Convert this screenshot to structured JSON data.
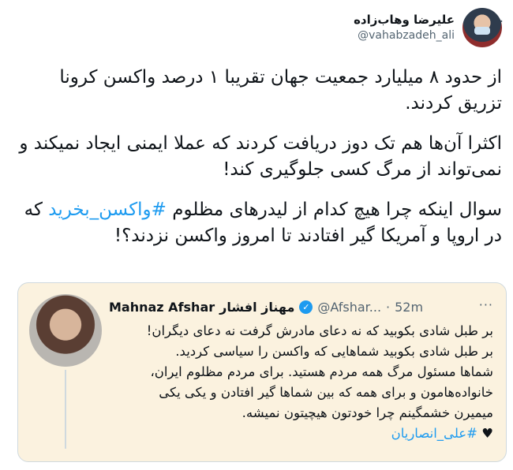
{
  "tweet": {
    "author": {
      "display_name": "علیرضا وهاب‌زاده",
      "handle": "@vahabzadeh_ali",
      "avatar_icon": "user-avatar"
    },
    "more_icon": "···",
    "paragraphs": [
      "از حدود ۸ میلیارد جمعیت جهان تقریبا ۱ درصد واکسن کرونا تزریق کردند.",
      "اکثرا آن‌ها هم تک دوز دریافت کردند که عملا ایمنی ایجاد نمیکند و نمی‌تواند از مرگ کسی جلوگیری کند!"
    ],
    "paragraph3": {
      "before": "سوال اینکه چرا هیچ کدام از لیدرهای مظلوم ",
      "hashtag": "#واکسن_بخرید",
      "after": " که در اروپا و آمریکا گیر افتادند تا امروز واکسن نزدند؟!"
    }
  },
  "quote": {
    "name_en": "Mahnaz Afshar",
    "name_fa": "مهناز افشار",
    "verified_icon": "✓",
    "handle": "@Afshar...",
    "dot": "·",
    "time": "52m",
    "more_icon": "···",
    "lines": [
      "بر طبل شادی بکوبید که نه دعای مادرش گرفت نه دعای دیگران!",
      "بر طبل شادی بکوبید شماهایی که واکسن را سیاسی کردید.",
      "شماها مسئول مرگ همه مردم هستید. برای مردم مظلوم ایران،",
      "خانواده‌هامون و برای همه که بین شماها گیر افتادن و یکی یکی",
      "میمیرن خشمگینم چرا خودتون هیچیتون نمیشه."
    ],
    "heart": "♥",
    "hashtag": "#علی_انصاریان"
  },
  "colors": {
    "text": "#0f1419",
    "secondary": "#536471",
    "link": "#1d9bf0",
    "quote_bg": "#fbf2df",
    "border": "#cfd9de"
  }
}
